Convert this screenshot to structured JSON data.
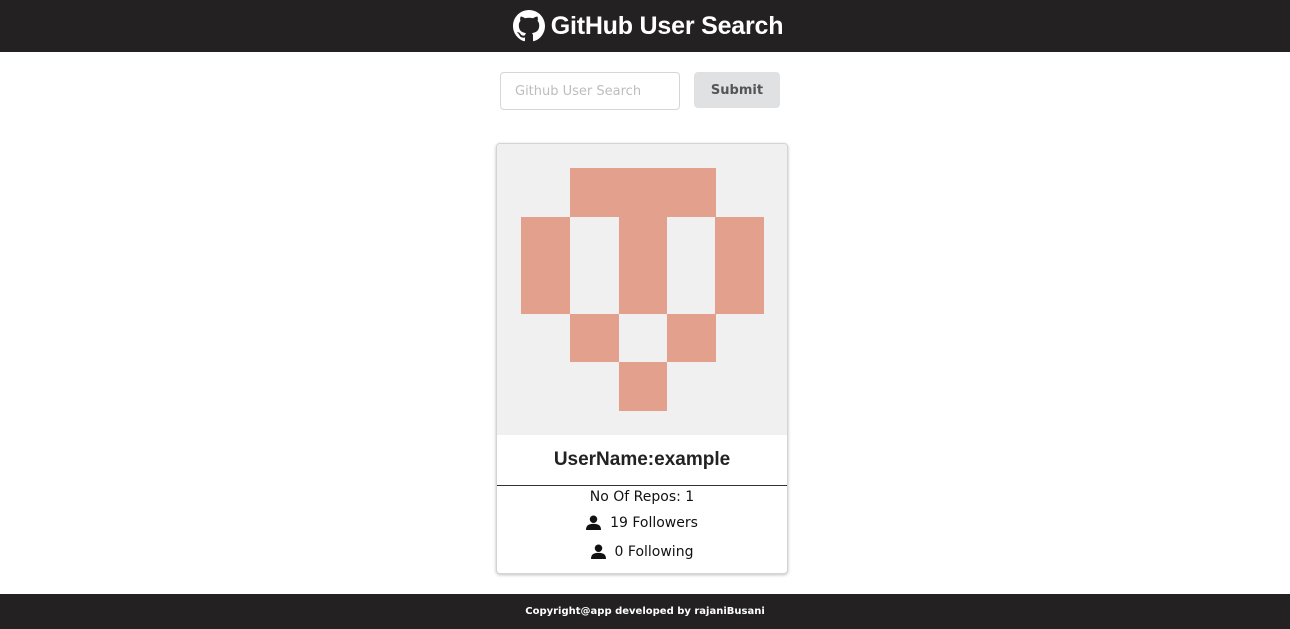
{
  "header": {
    "title": "GitHub User Search",
    "icon": "github-icon"
  },
  "search": {
    "placeholder": "Github User Search",
    "value": "",
    "submit_label": "Submit"
  },
  "profile": {
    "avatar_icon": "identicon-avatar",
    "avatar_color": "#e2a08d",
    "avatar_bg": "#f0f0f0",
    "username": "UserName:example",
    "repos": "No Of Repos: 1",
    "followers": "19 Followers",
    "following": "0 Following",
    "stat_icon": "user-icon"
  },
  "footer": {
    "copyright": "Copyright@app developed by rajaniBusani"
  },
  "colors": {
    "bar_bg": "#232121",
    "button_bg": "#e0e1e2"
  }
}
